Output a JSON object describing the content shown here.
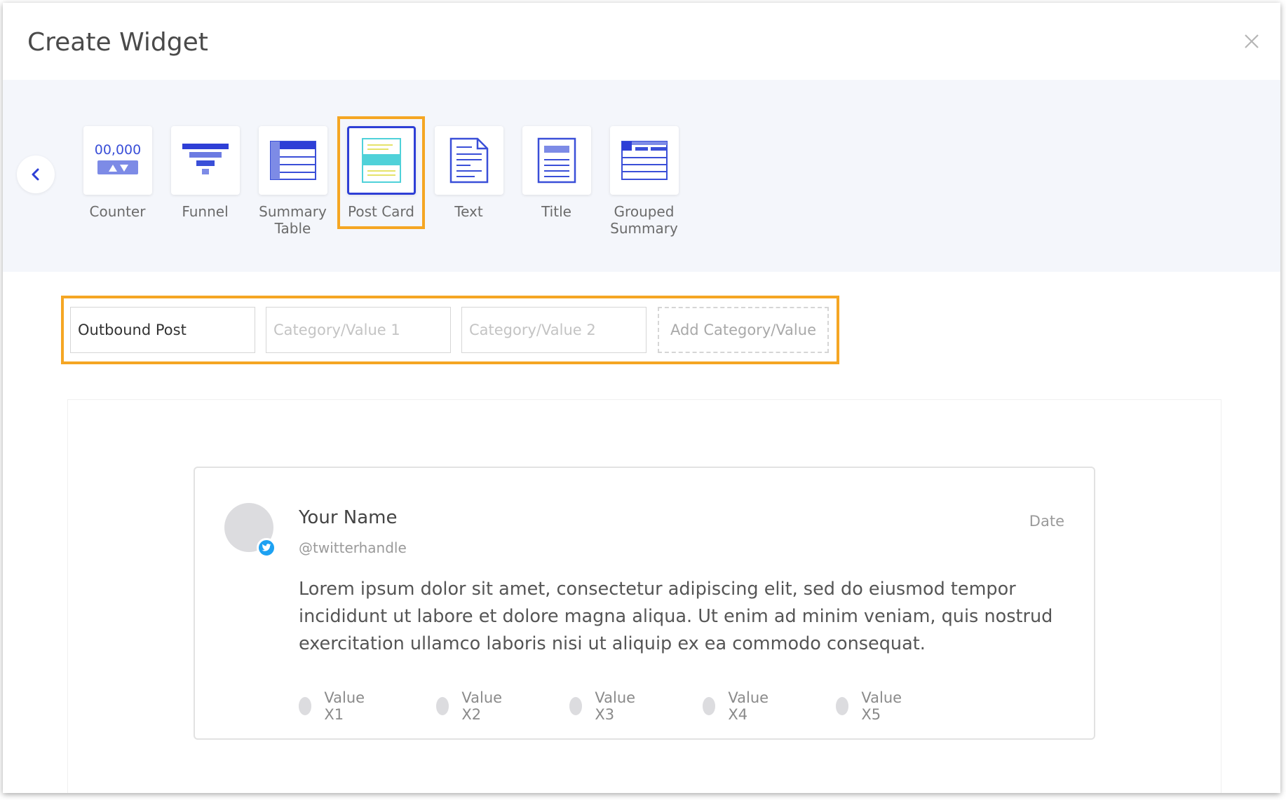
{
  "modal": {
    "title": "Create Widget"
  },
  "widget_types": [
    {
      "label": "Counter",
      "icon": "counter-icon",
      "counter_text": "00,000"
    },
    {
      "label": "Funnel",
      "icon": "funnel-icon"
    },
    {
      "label": "Summary\nTable",
      "icon": "summary-table-icon"
    },
    {
      "label": "Post Card",
      "icon": "post-card-icon",
      "selected": true
    },
    {
      "label": "Text",
      "icon": "text-doc-icon"
    },
    {
      "label": "Title",
      "icon": "title-doc-icon"
    },
    {
      "label": "Grouped\nSummary",
      "icon": "grouped-summary-icon"
    }
  ],
  "fields": {
    "primary_value": "Outbound Post",
    "category1_placeholder": "Category/Value 1",
    "category2_placeholder": "Category/Value 2",
    "add_label": "Add Category/Value"
  },
  "post": {
    "name": "Your Name",
    "handle": "@twitterhandle",
    "date": "Date",
    "body": "Lorem ipsum dolor sit amet, consectetur adipiscing elit, sed do eiusmod tempor incididunt ut labore et dolore magna aliqua. Ut enim ad minim veniam, quis nostrud exercitation ullamco laboris nisi ut aliquip ex ea commodo consequat.",
    "values": [
      "Value X1",
      "Value X2",
      "Value X3",
      "Value X4",
      "Value X5"
    ]
  },
  "colors": {
    "accent": "#2e3fd6",
    "highlight": "#f5a623",
    "icon_blue": "#3a4fd8",
    "icon_light_blue": "#7d8be6",
    "postcard_teal": "#4fd1d9",
    "postcard_yellow": "#e5e36a",
    "twitter": "#1da1f2"
  }
}
